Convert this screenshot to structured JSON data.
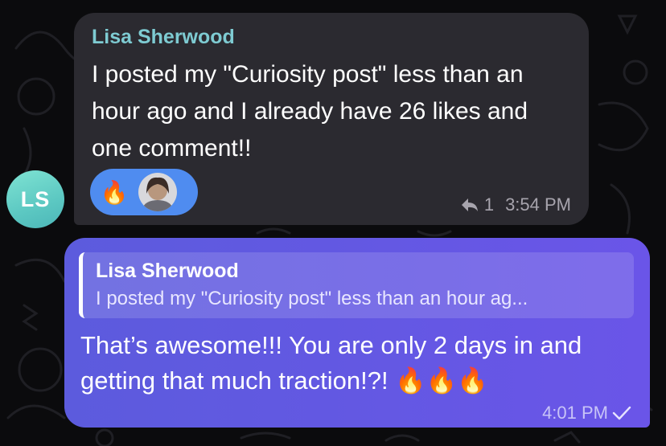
{
  "incoming": {
    "sender": "Lisa Sherwood",
    "avatar_initials": "LS",
    "text": "I posted my \"Curiosity post\" less than an hour ago and I already have 26 likes and one comment!!",
    "reaction_emoji": "🔥",
    "reply_count": "1",
    "time": "3:54 PM"
  },
  "outgoing": {
    "quote_sender": "Lisa Sherwood",
    "quote_text": "I posted my \"Curiosity post\" less than an hour ag...",
    "text": "That’s awesome!!! You are only 2 days in and getting that much traction!?! 🔥🔥🔥",
    "time": "4:01 PM"
  },
  "colors": {
    "incoming_bubble": "#2b2a30",
    "outgoing_bubble": "#6a55e8",
    "sender_name": "#7ecbd2",
    "reaction_pill": "#4f8cf0",
    "avatar_teal": "#5cc8c2"
  },
  "icons": [
    "reply-icon",
    "read-check-icon",
    "reactor-avatar-icon"
  ]
}
